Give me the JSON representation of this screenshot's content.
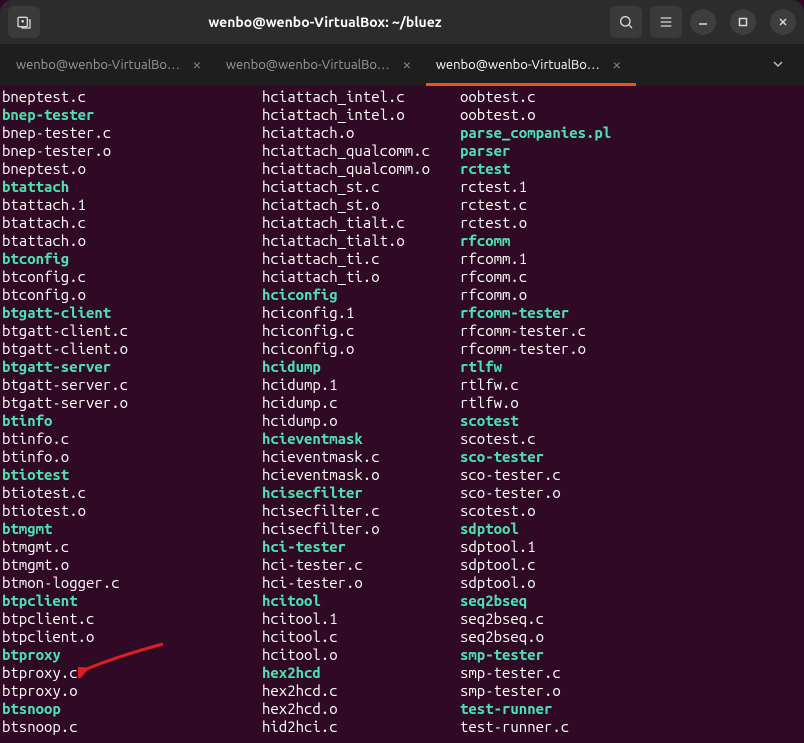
{
  "titlebar": {
    "title": "wenbo@wenbo-VirtualBox: ~/bluez"
  },
  "tabs": [
    {
      "label": "wenbo@wenbo-VirtualBo…",
      "active": false
    },
    {
      "label": "wenbo@wenbo-VirtualBo…",
      "active": false
    },
    {
      "label": "wenbo@wenbo-VirtualBo…",
      "active": true
    }
  ],
  "ls": {
    "col1": [
      {
        "name": "bneptest.c",
        "type": "plain"
      },
      {
        "name": "bnep-tester",
        "type": "exec"
      },
      {
        "name": "bnep-tester.c",
        "type": "plain"
      },
      {
        "name": "bnep-tester.o",
        "type": "plain"
      },
      {
        "name": "bneptest.o",
        "type": "plain"
      },
      {
        "name": "btattach",
        "type": "exec"
      },
      {
        "name": "btattach.1",
        "type": "plain"
      },
      {
        "name": "btattach.c",
        "type": "plain"
      },
      {
        "name": "btattach.o",
        "type": "plain"
      },
      {
        "name": "btconfig",
        "type": "exec"
      },
      {
        "name": "btconfig.c",
        "type": "plain"
      },
      {
        "name": "btconfig.o",
        "type": "plain"
      },
      {
        "name": "btgatt-client",
        "type": "exec"
      },
      {
        "name": "btgatt-client.c",
        "type": "plain"
      },
      {
        "name": "btgatt-client.o",
        "type": "plain"
      },
      {
        "name": "btgatt-server",
        "type": "exec"
      },
      {
        "name": "btgatt-server.c",
        "type": "plain"
      },
      {
        "name": "btgatt-server.o",
        "type": "plain"
      },
      {
        "name": "btinfo",
        "type": "exec"
      },
      {
        "name": "btinfo.c",
        "type": "plain"
      },
      {
        "name": "btinfo.o",
        "type": "plain"
      },
      {
        "name": "btiotest",
        "type": "exec"
      },
      {
        "name": "btiotest.c",
        "type": "plain"
      },
      {
        "name": "btiotest.o",
        "type": "plain"
      },
      {
        "name": "btmgmt",
        "type": "exec"
      },
      {
        "name": "btmgmt.c",
        "type": "plain"
      },
      {
        "name": "btmgmt.o",
        "type": "plain"
      },
      {
        "name": "btmon-logger.c",
        "type": "plain"
      },
      {
        "name": "btpclient",
        "type": "exec"
      },
      {
        "name": "btpclient.c",
        "type": "plain"
      },
      {
        "name": "btpclient.o",
        "type": "plain"
      },
      {
        "name": "btproxy",
        "type": "exec"
      },
      {
        "name": "btproxy.c",
        "type": "plain"
      },
      {
        "name": "btproxy.o",
        "type": "plain"
      },
      {
        "name": "btsnoop",
        "type": "exec"
      },
      {
        "name": "btsnoop.c",
        "type": "plain"
      }
    ],
    "col2": [
      {
        "name": "hciattach_intel.c",
        "type": "plain"
      },
      {
        "name": "hciattach_intel.o",
        "type": "plain"
      },
      {
        "name": "hciattach.o",
        "type": "plain"
      },
      {
        "name": "hciattach_qualcomm.c",
        "type": "plain"
      },
      {
        "name": "hciattach_qualcomm.o",
        "type": "plain"
      },
      {
        "name": "hciattach_st.c",
        "type": "plain"
      },
      {
        "name": "hciattach_st.o",
        "type": "plain"
      },
      {
        "name": "hciattach_tialt.c",
        "type": "plain"
      },
      {
        "name": "hciattach_tialt.o",
        "type": "plain"
      },
      {
        "name": "hciattach_ti.c",
        "type": "plain"
      },
      {
        "name": "hciattach_ti.o",
        "type": "plain"
      },
      {
        "name": "hciconfig",
        "type": "exec"
      },
      {
        "name": "hciconfig.1",
        "type": "plain"
      },
      {
        "name": "hciconfig.c",
        "type": "plain"
      },
      {
        "name": "hciconfig.o",
        "type": "plain"
      },
      {
        "name": "hcidump",
        "type": "exec"
      },
      {
        "name": "hcidump.1",
        "type": "plain"
      },
      {
        "name": "hcidump.c",
        "type": "plain"
      },
      {
        "name": "hcidump.o",
        "type": "plain"
      },
      {
        "name": "hcieventmask",
        "type": "exec"
      },
      {
        "name": "hcieventmask.c",
        "type": "plain"
      },
      {
        "name": "hcieventmask.o",
        "type": "plain"
      },
      {
        "name": "hcisecfilter",
        "type": "exec"
      },
      {
        "name": "hcisecfilter.c",
        "type": "plain"
      },
      {
        "name": "hcisecfilter.o",
        "type": "plain"
      },
      {
        "name": "hci-tester",
        "type": "exec"
      },
      {
        "name": "hci-tester.c",
        "type": "plain"
      },
      {
        "name": "hci-tester.o",
        "type": "plain"
      },
      {
        "name": "hcitool",
        "type": "exec"
      },
      {
        "name": "hcitool.1",
        "type": "plain"
      },
      {
        "name": "hcitool.c",
        "type": "plain"
      },
      {
        "name": "hcitool.o",
        "type": "plain"
      },
      {
        "name": "hex2hcd",
        "type": "exec"
      },
      {
        "name": "hex2hcd.c",
        "type": "plain"
      },
      {
        "name": "hex2hcd.o",
        "type": "plain"
      },
      {
        "name": "hid2hci.c",
        "type": "plain"
      }
    ],
    "col3": [
      {
        "name": "oobtest.c",
        "type": "plain"
      },
      {
        "name": "oobtest.o",
        "type": "plain"
      },
      {
        "name": "parse_companies.pl",
        "type": "exec"
      },
      {
        "name": "parser",
        "type": "exec"
      },
      {
        "name": "rctest",
        "type": "exec"
      },
      {
        "name": "rctest.1",
        "type": "plain"
      },
      {
        "name": "rctest.c",
        "type": "plain"
      },
      {
        "name": "rctest.o",
        "type": "plain"
      },
      {
        "name": "rfcomm",
        "type": "exec"
      },
      {
        "name": "rfcomm.1",
        "type": "plain"
      },
      {
        "name": "rfcomm.c",
        "type": "plain"
      },
      {
        "name": "rfcomm.o",
        "type": "plain"
      },
      {
        "name": "rfcomm-tester",
        "type": "exec"
      },
      {
        "name": "rfcomm-tester.c",
        "type": "plain"
      },
      {
        "name": "rfcomm-tester.o",
        "type": "plain"
      },
      {
        "name": "rtlfw",
        "type": "exec"
      },
      {
        "name": "rtlfw.c",
        "type": "plain"
      },
      {
        "name": "rtlfw.o",
        "type": "plain"
      },
      {
        "name": "scotest",
        "type": "exec"
      },
      {
        "name": "scotest.c",
        "type": "plain"
      },
      {
        "name": "sco-tester",
        "type": "exec"
      },
      {
        "name": "sco-tester.c",
        "type": "plain"
      },
      {
        "name": "sco-tester.o",
        "type": "plain"
      },
      {
        "name": "scotest.o",
        "type": "plain"
      },
      {
        "name": "sdptool",
        "type": "exec"
      },
      {
        "name": "sdptool.1",
        "type": "plain"
      },
      {
        "name": "sdptool.c",
        "type": "plain"
      },
      {
        "name": "sdptool.o",
        "type": "plain"
      },
      {
        "name": "seq2bseq",
        "type": "exec"
      },
      {
        "name": "seq2bseq.c",
        "type": "plain"
      },
      {
        "name": "seq2bseq.o",
        "type": "plain"
      },
      {
        "name": "smp-tester",
        "type": "exec"
      },
      {
        "name": "smp-tester.c",
        "type": "plain"
      },
      {
        "name": "smp-tester.o",
        "type": "plain"
      },
      {
        "name": "test-runner",
        "type": "exec"
      },
      {
        "name": "test-runner.c",
        "type": "plain"
      }
    ]
  }
}
